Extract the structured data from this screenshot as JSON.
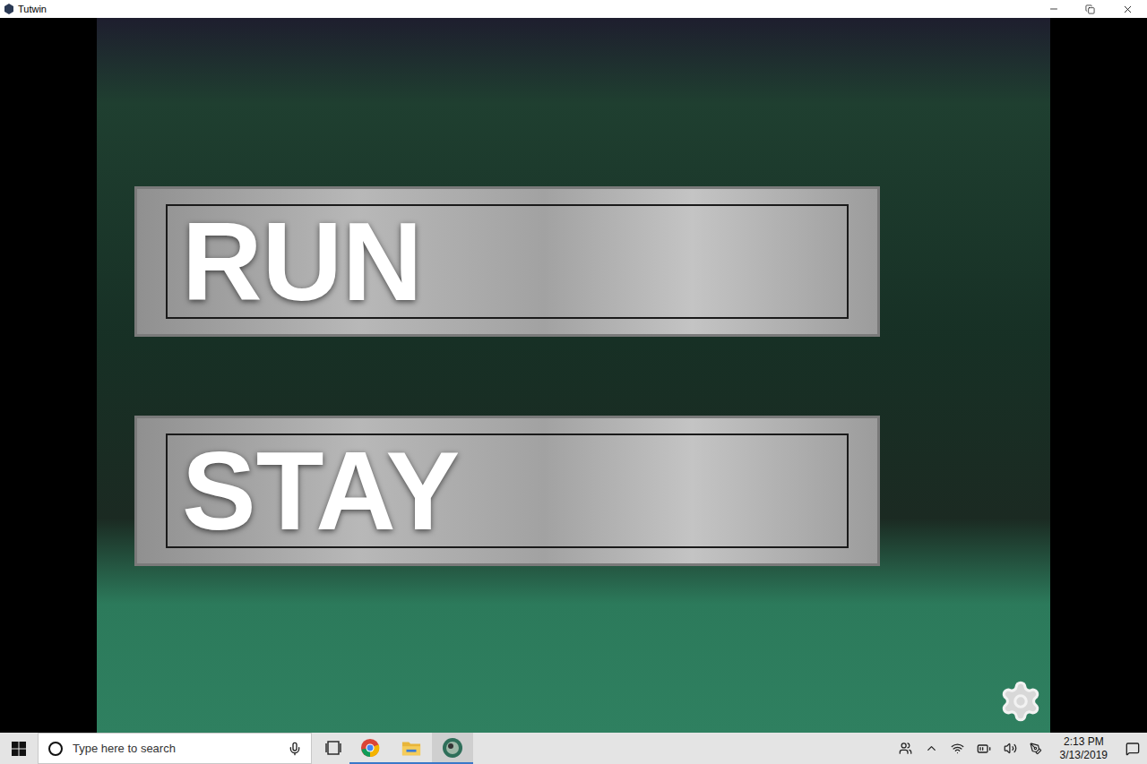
{
  "window": {
    "title": "Tutwin"
  },
  "choices": [
    {
      "label": "RUN"
    },
    {
      "label": "STAY"
    }
  ],
  "taskbar": {
    "search": {
      "placeholder": "Type here to search"
    },
    "apps": [
      {
        "kind": "taskview",
        "active": false,
        "running": false
      },
      {
        "kind": "chrome",
        "active": false,
        "running": true
      },
      {
        "kind": "explorer",
        "active": false,
        "running": true
      },
      {
        "kind": "game",
        "active": true,
        "running": true
      }
    ],
    "clock": {
      "time": "2:13 PM",
      "date": "3/13/2019"
    }
  }
}
